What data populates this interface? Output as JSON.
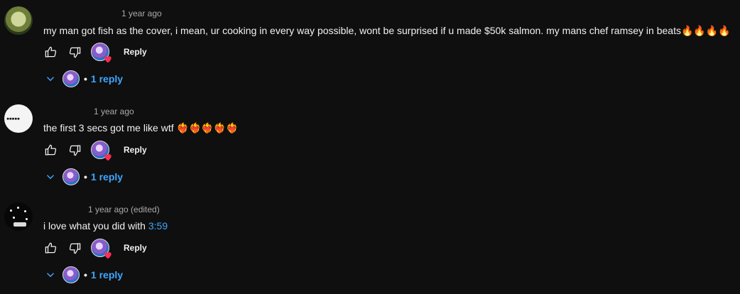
{
  "comments": [
    {
      "time": "1 year ago",
      "text": "my man got fish as the cover, i mean, ur cooking in every way possible, wont be surprised if u made $50k salmon. my mans chef ramsey in beats🔥🔥🔥🔥",
      "timestamp_link": "",
      "reply_label": "Reply",
      "replies_label": "1 reply"
    },
    {
      "time": "1 year ago",
      "text": "the first 3 secs got me like wtf ❤️‍🔥❤️‍🔥❤️‍🔥❤️‍🔥❤️‍🔥",
      "timestamp_link": "",
      "reply_label": "Reply",
      "replies_label": "1 reply"
    },
    {
      "time": "1 year ago (edited)",
      "text": "i love what you did with ",
      "timestamp_link": "3:59",
      "reply_label": "Reply",
      "replies_label": "1 reply"
    }
  ],
  "colors": {
    "background": "#0f0f0f",
    "link": "#3ea6ff",
    "meta": "#aaaaaa",
    "heart": "#ff2d55"
  },
  "icons": {
    "like": "thumbs-up-icon",
    "dislike": "thumbs-down-icon",
    "expand": "chevron-down-icon",
    "heart": "heart-icon"
  }
}
